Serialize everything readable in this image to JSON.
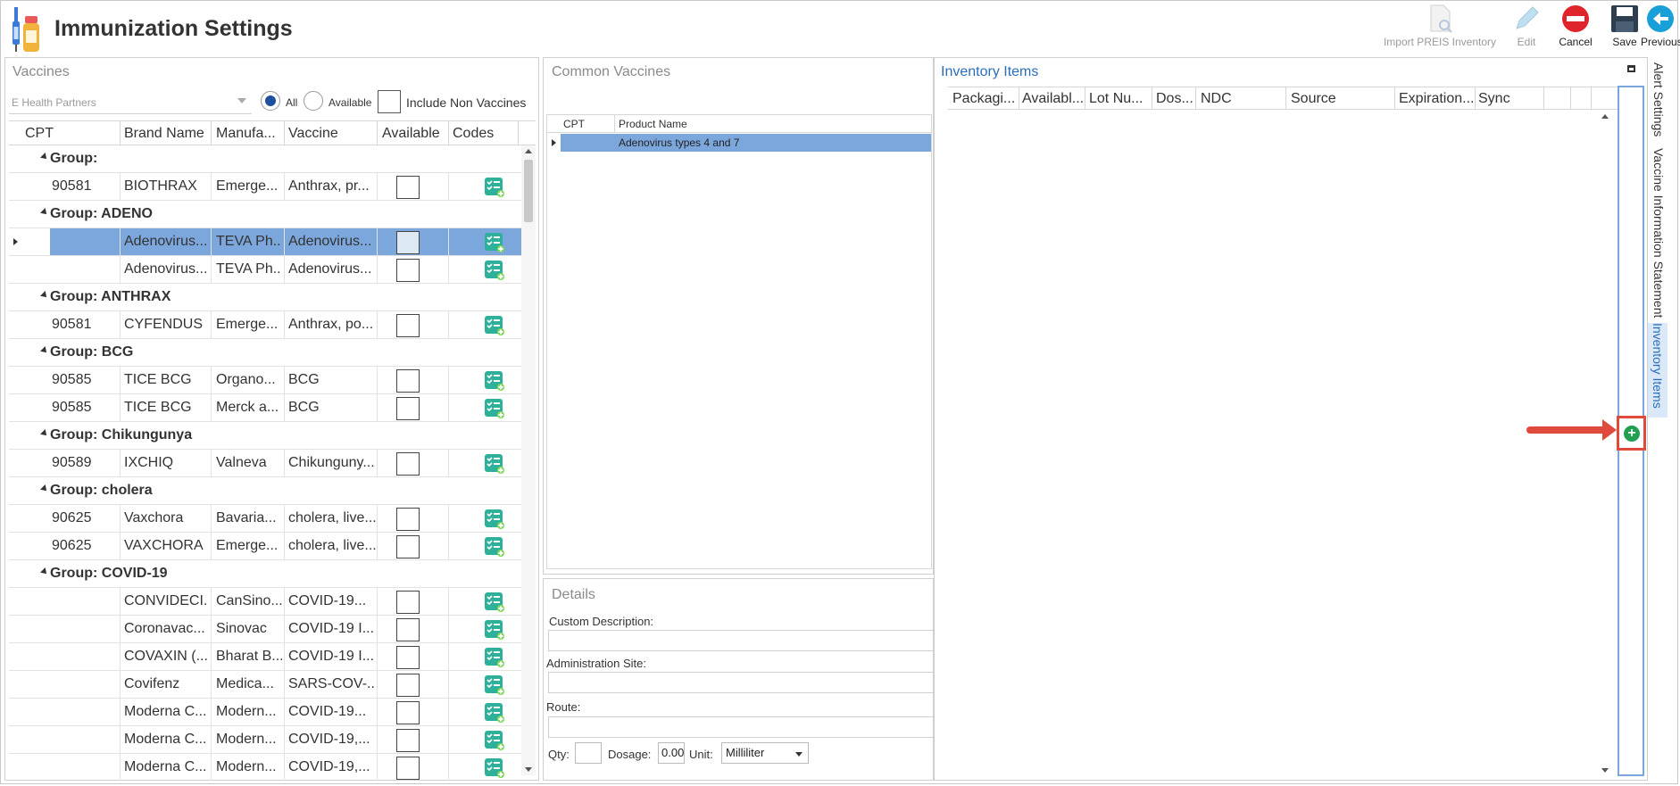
{
  "header": {
    "title": "Immunization Settings"
  },
  "toolbar": {
    "import_label": "Import PREIS Inventory",
    "edit_label": "Edit",
    "cancel_label": "Cancel",
    "save_label": "Save",
    "previous_label": "Previous"
  },
  "vaccines_panel": {
    "title": "Vaccines",
    "filter_value": "E Health Partners",
    "radio_all": "All",
    "radio_available": "Available",
    "include_non_vaccines": "Include Non Vaccines",
    "columns": [
      "CPT",
      "Brand Name",
      "Manufa...",
      "Vaccine",
      "Available",
      "Codes"
    ],
    "groups": {
      "g0": "Group:",
      "g1": "Group: ADENO",
      "g2": "Group: ANTHRAX",
      "g3": "Group: BCG",
      "g4": "Group: Chikungunya",
      "g5": "Group: cholera",
      "g6": "Group: COVID-19"
    },
    "rows": {
      "r1": {
        "cpt": "90581",
        "brand": "BIOTHRAX",
        "manufacturer": "Emerge...",
        "vaccine": "Anthrax, pr..."
      },
      "r2": {
        "cpt": "",
        "brand": "Adenovirus...",
        "manufacturer": "TEVA Ph...",
        "vaccine": "Adenovirus..."
      },
      "r3": {
        "cpt": "",
        "brand": "Adenovirus...",
        "manufacturer": "TEVA Ph...",
        "vaccine": "Adenovirus..."
      },
      "r4": {
        "cpt": "90581",
        "brand": "CYFENDUS",
        "manufacturer": "Emerge...",
        "vaccine": "Anthrax, po..."
      },
      "r5": {
        "cpt": "90585",
        "brand": "TICE BCG",
        "manufacturer": "Organo...",
        "vaccine": "BCG"
      },
      "r6": {
        "cpt": "90585",
        "brand": "TICE BCG",
        "manufacturer": "Merck a...",
        "vaccine": "BCG"
      },
      "r7": {
        "cpt": "90589",
        "brand": "IXCHIQ",
        "manufacturer": "Valneva",
        "vaccine": "Chikunguny..."
      },
      "r8": {
        "cpt": "90625",
        "brand": "Vaxchora",
        "manufacturer": "Bavaria...",
        "vaccine": "cholera, live..."
      },
      "r9": {
        "cpt": "90625",
        "brand": "VAXCHORA",
        "manufacturer": "Emerge...",
        "vaccine": "cholera, live..."
      },
      "r10": {
        "cpt": "",
        "brand": "CONVIDECI...",
        "manufacturer": "CanSino...",
        "vaccine": "COVID-19..."
      },
      "r11": {
        "cpt": "",
        "brand": "Coronavac...",
        "manufacturer": "Sinovac",
        "vaccine": "COVID-19 I..."
      },
      "r12": {
        "cpt": "",
        "brand": "COVAXIN (...",
        "manufacturer": "Bharat B...",
        "vaccine": "COVID-19 I..."
      },
      "r13": {
        "cpt": "",
        "brand": "Covifenz",
        "manufacturer": "Medica...",
        "vaccine": "SARS-COV-..."
      },
      "r14": {
        "cpt": "",
        "brand": "Moderna C...",
        "manufacturer": "Modern...",
        "vaccine": "COVID-19..."
      },
      "r15": {
        "cpt": "",
        "brand": "Moderna C...",
        "manufacturer": "Modern...",
        "vaccine": "COVID-19,..."
      },
      "r16": {
        "cpt": "",
        "brand": "Moderna C...",
        "manufacturer": "Modern...",
        "vaccine": "COVID-19,..."
      }
    }
  },
  "common_vaccines": {
    "title": "Common Vaccines",
    "columns": [
      "CPT",
      "Product Name"
    ],
    "rows": [
      {
        "cpt": "",
        "product_name": "Adenovirus types 4 and 7"
      }
    ]
  },
  "details": {
    "title": "Details",
    "custom_description_label": "Custom Description:",
    "administration_site_label": "Administration Site:",
    "route_label": "Route:",
    "qty_label": "Qty:",
    "qty_value": "",
    "dosage_label": "Dosage:",
    "dosage_value": "0.00",
    "unit_label": "Unit:",
    "unit_value": "Milliliter"
  },
  "inventory": {
    "title": "Inventory Items",
    "columns": [
      "Packagi...",
      "Availabl...",
      "Lot Nu...",
      "Dos...",
      "NDC",
      "Source",
      "Expiration...",
      "Sync"
    ]
  },
  "side_tabs": {
    "alert_settings": "Alert Settings",
    "vis": "Vaccine Information Statement",
    "inventory_items": "Inventory Items"
  },
  "colors": {
    "selection": "#7ca7dc",
    "accent_blue": "#2a6ebb",
    "callout_red": "#e04a3c",
    "add_green": "#20a050"
  }
}
